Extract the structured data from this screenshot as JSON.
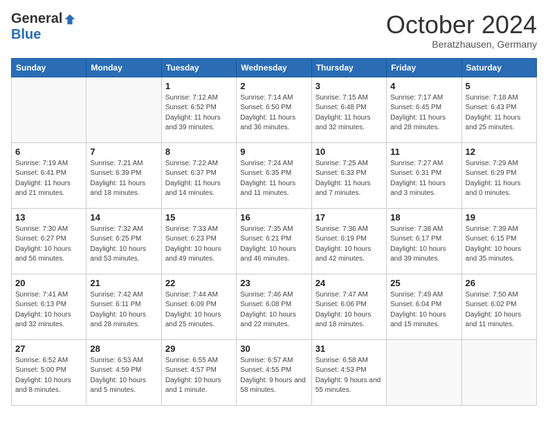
{
  "header": {
    "logo_general": "General",
    "logo_blue": "Blue",
    "month_title": "October 2024",
    "location": "Beratzhausen, Germany"
  },
  "days": [
    "Sunday",
    "Monday",
    "Tuesday",
    "Wednesday",
    "Thursday",
    "Friday",
    "Saturday"
  ],
  "weeks": [
    [
      {
        "day": "",
        "info": ""
      },
      {
        "day": "",
        "info": ""
      },
      {
        "day": "1",
        "info": "Sunrise: 7:12 AM\nSunset: 6:52 PM\nDaylight: 11 hours and 39 minutes."
      },
      {
        "day": "2",
        "info": "Sunrise: 7:14 AM\nSunset: 6:50 PM\nDaylight: 11 hours and 36 minutes."
      },
      {
        "day": "3",
        "info": "Sunrise: 7:15 AM\nSunset: 6:48 PM\nDaylight: 11 hours and 32 minutes."
      },
      {
        "day": "4",
        "info": "Sunrise: 7:17 AM\nSunset: 6:45 PM\nDaylight: 11 hours and 28 minutes."
      },
      {
        "day": "5",
        "info": "Sunrise: 7:18 AM\nSunset: 6:43 PM\nDaylight: 11 hours and 25 minutes."
      }
    ],
    [
      {
        "day": "6",
        "info": "Sunrise: 7:19 AM\nSunset: 6:41 PM\nDaylight: 11 hours and 21 minutes."
      },
      {
        "day": "7",
        "info": "Sunrise: 7:21 AM\nSunset: 6:39 PM\nDaylight: 11 hours and 18 minutes."
      },
      {
        "day": "8",
        "info": "Sunrise: 7:22 AM\nSunset: 6:37 PM\nDaylight: 11 hours and 14 minutes."
      },
      {
        "day": "9",
        "info": "Sunrise: 7:24 AM\nSunset: 6:35 PM\nDaylight: 11 hours and 11 minutes."
      },
      {
        "day": "10",
        "info": "Sunrise: 7:25 AM\nSunset: 6:33 PM\nDaylight: 11 hours and 7 minutes."
      },
      {
        "day": "11",
        "info": "Sunrise: 7:27 AM\nSunset: 6:31 PM\nDaylight: 11 hours and 3 minutes."
      },
      {
        "day": "12",
        "info": "Sunrise: 7:29 AM\nSunset: 6:29 PM\nDaylight: 11 hours and 0 minutes."
      }
    ],
    [
      {
        "day": "13",
        "info": "Sunrise: 7:30 AM\nSunset: 6:27 PM\nDaylight: 10 hours and 56 minutes."
      },
      {
        "day": "14",
        "info": "Sunrise: 7:32 AM\nSunset: 6:25 PM\nDaylight: 10 hours and 53 minutes."
      },
      {
        "day": "15",
        "info": "Sunrise: 7:33 AM\nSunset: 6:23 PM\nDaylight: 10 hours and 49 minutes."
      },
      {
        "day": "16",
        "info": "Sunrise: 7:35 AM\nSunset: 6:21 PM\nDaylight: 10 hours and 46 minutes."
      },
      {
        "day": "17",
        "info": "Sunrise: 7:36 AM\nSunset: 6:19 PM\nDaylight: 10 hours and 42 minutes."
      },
      {
        "day": "18",
        "info": "Sunrise: 7:38 AM\nSunset: 6:17 PM\nDaylight: 10 hours and 39 minutes."
      },
      {
        "day": "19",
        "info": "Sunrise: 7:39 AM\nSunset: 6:15 PM\nDaylight: 10 hours and 35 minutes."
      }
    ],
    [
      {
        "day": "20",
        "info": "Sunrise: 7:41 AM\nSunset: 6:13 PM\nDaylight: 10 hours and 32 minutes."
      },
      {
        "day": "21",
        "info": "Sunrise: 7:42 AM\nSunset: 6:11 PM\nDaylight: 10 hours and 28 minutes."
      },
      {
        "day": "22",
        "info": "Sunrise: 7:44 AM\nSunset: 6:09 PM\nDaylight: 10 hours and 25 minutes."
      },
      {
        "day": "23",
        "info": "Sunrise: 7:46 AM\nSunset: 6:08 PM\nDaylight: 10 hours and 22 minutes."
      },
      {
        "day": "24",
        "info": "Sunrise: 7:47 AM\nSunset: 6:06 PM\nDaylight: 10 hours and 18 minutes."
      },
      {
        "day": "25",
        "info": "Sunrise: 7:49 AM\nSunset: 6:04 PM\nDaylight: 10 hours and 15 minutes."
      },
      {
        "day": "26",
        "info": "Sunrise: 7:50 AM\nSunset: 6:02 PM\nDaylight: 10 hours and 11 minutes."
      }
    ],
    [
      {
        "day": "27",
        "info": "Sunrise: 6:52 AM\nSunset: 5:00 PM\nDaylight: 10 hours and 8 minutes."
      },
      {
        "day": "28",
        "info": "Sunrise: 6:53 AM\nSunset: 4:59 PM\nDaylight: 10 hours and 5 minutes."
      },
      {
        "day": "29",
        "info": "Sunrise: 6:55 AM\nSunset: 4:57 PM\nDaylight: 10 hours and 1 minute."
      },
      {
        "day": "30",
        "info": "Sunrise: 6:57 AM\nSunset: 4:55 PM\nDaylight: 9 hours and 58 minutes."
      },
      {
        "day": "31",
        "info": "Sunrise: 6:58 AM\nSunset: 4:53 PM\nDaylight: 9 hours and 55 minutes."
      },
      {
        "day": "",
        "info": ""
      },
      {
        "day": "",
        "info": ""
      }
    ]
  ]
}
